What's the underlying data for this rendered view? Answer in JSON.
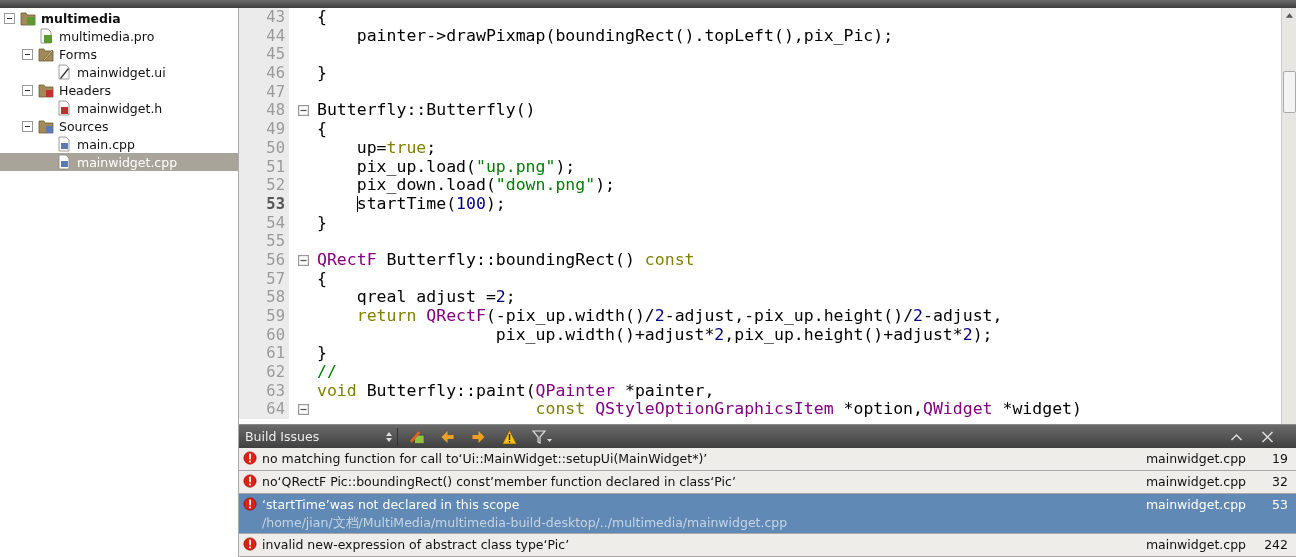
{
  "project_tree": [
    {
      "label": "multimedia",
      "kind": "project",
      "bold": true,
      "expanded": true,
      "selected": false,
      "children": [
        {
          "label": "multimedia.pro",
          "kind": "project-file",
          "bold": false,
          "selected": false
        },
        {
          "label": "Forms",
          "kind": "forms-folder",
          "bold": false,
          "expanded": true,
          "selected": false,
          "children": [
            {
              "label": "mainwidget.ui",
              "kind": "ui-file",
              "bold": false,
              "selected": false
            }
          ]
        },
        {
          "label": "Headers",
          "kind": "headers-folder",
          "bold": false,
          "expanded": true,
          "selected": false,
          "children": [
            {
              "label": "mainwidget.h",
              "kind": "header-file",
              "bold": false,
              "selected": false
            }
          ]
        },
        {
          "label": "Sources",
          "kind": "sources-folder",
          "bold": false,
          "expanded": true,
          "selected": false,
          "children": [
            {
              "label": "main.cpp",
              "kind": "source-file",
              "bold": false,
              "selected": false
            },
            {
              "label": "mainwidget.cpp",
              "kind": "source-file",
              "bold": false,
              "selected": true
            }
          ]
        }
      ]
    }
  ],
  "editor": {
    "lines": [
      {
        "number": "43",
        "current": false,
        "fold": false,
        "tokens": [
          {
            "kind": "plain",
            "text": "{"
          }
        ]
      },
      {
        "number": "44",
        "current": false,
        "fold": false,
        "tokens": [
          {
            "kind": "plain",
            "text": "    painter->drawPixmap(boundingRect().topLeft(),pix_Pic);"
          }
        ]
      },
      {
        "number": "45",
        "current": false,
        "fold": false
      },
      {
        "number": "46",
        "current": false,
        "fold": false,
        "tokens": [
          {
            "kind": "plain",
            "text": "}"
          }
        ]
      },
      {
        "number": "47",
        "current": false,
        "fold": false
      },
      {
        "number": "48",
        "current": false,
        "fold": true,
        "tokens": [
          {
            "kind": "plain",
            "text": "Butterfly::Butterfly()"
          }
        ]
      },
      {
        "number": "49",
        "current": false,
        "fold": false,
        "tokens": [
          {
            "kind": "plain",
            "text": "{"
          }
        ]
      },
      {
        "number": "50",
        "current": false,
        "fold": false,
        "tokens": [
          {
            "kind": "plain",
            "text": "    up="
          },
          {
            "kind": "keyword",
            "text": "true"
          },
          {
            "kind": "plain",
            "text": ";"
          }
        ]
      },
      {
        "number": "51",
        "current": false,
        "fold": false,
        "tokens": [
          {
            "kind": "plain",
            "text": "    pix_up.load("
          },
          {
            "kind": "string",
            "text": "\"up.png\""
          },
          {
            "kind": "plain",
            "text": ");"
          }
        ]
      },
      {
        "number": "52",
        "current": false,
        "fold": false,
        "tokens": [
          {
            "kind": "plain",
            "text": "    pix_down.load("
          },
          {
            "kind": "string",
            "text": "\"down.png\""
          },
          {
            "kind": "plain",
            "text": ");"
          }
        ]
      },
      {
        "number": "53",
        "current": true,
        "fold": false,
        "tokens": [
          {
            "kind": "plain",
            "text": "    startTime("
          },
          {
            "kind": "number",
            "text": "100"
          },
          {
            "kind": "plain",
            "text": ");"
          }
        ]
      },
      {
        "number": "54",
        "current": false,
        "fold": false,
        "tokens": [
          {
            "kind": "plain",
            "text": "}"
          }
        ]
      },
      {
        "number": "55",
        "current": false,
        "fold": false
      },
      {
        "number": "56",
        "current": false,
        "fold": true,
        "tokens": [
          {
            "kind": "type",
            "text": "QRectF"
          },
          {
            "kind": "plain",
            "text": " Butterfly::boundingRect() "
          },
          {
            "kind": "keyword",
            "text": "const"
          }
        ]
      },
      {
        "number": "57",
        "current": false,
        "fold": false,
        "tokens": [
          {
            "kind": "plain",
            "text": "{"
          }
        ]
      },
      {
        "number": "58",
        "current": false,
        "fold": false,
        "tokens": [
          {
            "kind": "plain",
            "text": "    qreal adjust ="
          },
          {
            "kind": "number",
            "text": "2"
          },
          {
            "kind": "plain",
            "text": ";"
          }
        ]
      },
      {
        "number": "59",
        "current": false,
        "fold": false,
        "tokens": [
          {
            "kind": "keyword",
            "text": "    return"
          },
          {
            "kind": "type",
            "text": " QRectF"
          },
          {
            "kind": "plain",
            "text": "(-pix_up.width()/"
          },
          {
            "kind": "number",
            "text": "2"
          },
          {
            "kind": "plain",
            "text": "-adjust,-pix_up.height()/"
          },
          {
            "kind": "number",
            "text": "2"
          },
          {
            "kind": "plain",
            "text": "-adjust,"
          }
        ]
      },
      {
        "number": "60",
        "current": false,
        "fold": false,
        "tokens": [
          {
            "kind": "plain",
            "text": "                  pix_up.width()+adjust*"
          },
          {
            "kind": "number",
            "text": "2"
          },
          {
            "kind": "plain",
            "text": ",pix_up.height()+adjust*"
          },
          {
            "kind": "number",
            "text": "2"
          },
          {
            "kind": "plain",
            "text": ");"
          }
        ]
      },
      {
        "number": "61",
        "current": false,
        "fold": false,
        "tokens": [
          {
            "kind": "plain",
            "text": "}"
          }
        ]
      },
      {
        "number": "62",
        "current": false,
        "fold": false,
        "tokens": [
          {
            "kind": "comment",
            "text": "//"
          }
        ]
      },
      {
        "number": "63",
        "current": false,
        "fold": false,
        "tokens": [
          {
            "kind": "keyword",
            "text": "void"
          },
          {
            "kind": "plain",
            "text": " Butterfly::paint("
          },
          {
            "kind": "type",
            "text": "QPainter"
          },
          {
            "kind": "plain",
            "text": " *painter,"
          }
        ]
      },
      {
        "number": "64",
        "current": false,
        "fold": true,
        "tokens": [
          {
            "kind": "keyword",
            "text": "                      const"
          },
          {
            "kind": "type",
            "text": " QStyleOptionGraphicsItem"
          },
          {
            "kind": "plain",
            "text": " *option,"
          },
          {
            "kind": "type",
            "text": "QWidget"
          },
          {
            "kind": "plain",
            "text": " *widget)"
          }
        ]
      }
    ]
  },
  "build_issues": {
    "title": "Build Issues",
    "issues": [
      {
        "message": "no matching function for call to‘Ui::MainWidget::setupUi(MainWidget*)’",
        "file": "mainwidget.cpp",
        "line": "19",
        "selected": false
      },
      {
        "message": "no‘QRectF Pic::boundingRect() const’member function declared in class‘Pic’",
        "file": "mainwidget.cpp",
        "line": "32",
        "selected": false
      },
      {
        "message": "‘startTime’was not declared in this scope",
        "path": "/home/jian/文档/MultiMedia/multimedia-build-desktop/../multimedia/mainwidget.cpp",
        "file": "mainwidget.cpp",
        "line": "53",
        "selected": true
      },
      {
        "message": "invalid new-expression of abstract class type‘Pic’",
        "file": "mainwidget.cpp",
        "line": "242",
        "selected": false
      }
    ]
  }
}
